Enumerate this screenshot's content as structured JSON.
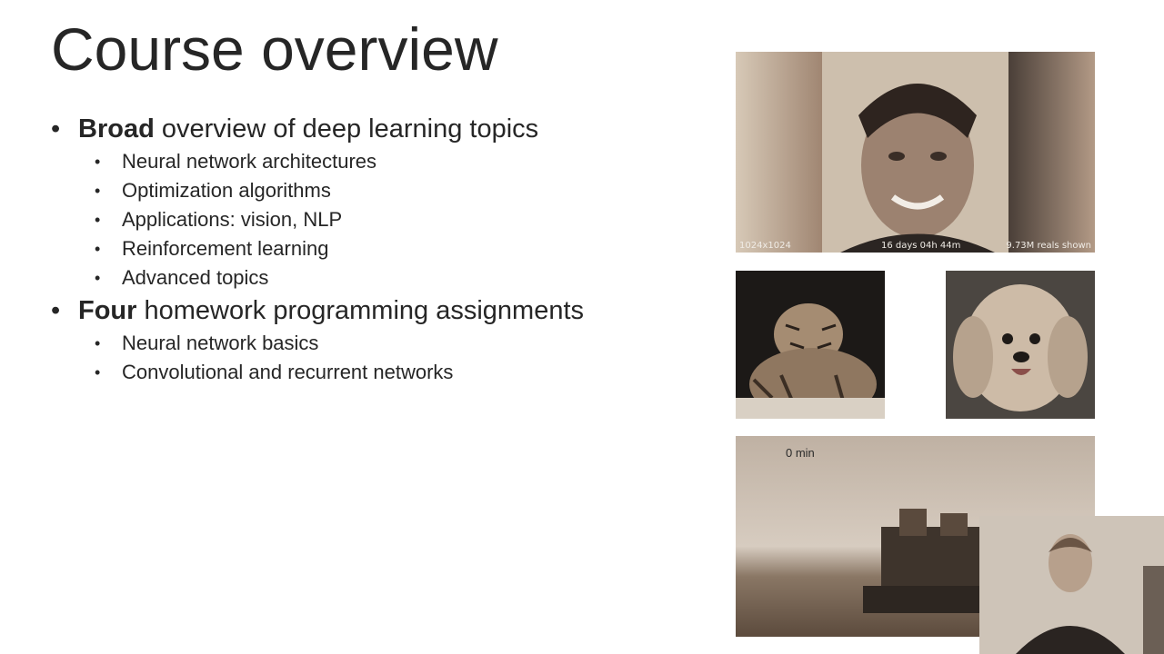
{
  "slide": {
    "title": "Course overview",
    "bullets": [
      {
        "bold": "Broad",
        "text": " overview of deep learning topics",
        "subitems": [
          "Neural network architectures",
          "Optimization algorithms",
          "Applications: vision, NLP",
          "Reinforcement learning",
          "Advanced topics"
        ]
      },
      {
        "bold": "Four",
        "text": " homework programming assignments",
        "subitems": [
          "Neural network basics",
          "Convolutional and recurrent networks"
        ]
      }
    ]
  },
  "images": {
    "faces": {
      "caption_left": "1024x1024",
      "caption_mid": "16 days 04h 44m",
      "caption_right": "9.73M reals shown"
    },
    "robot": {
      "label": "0 min"
    }
  }
}
